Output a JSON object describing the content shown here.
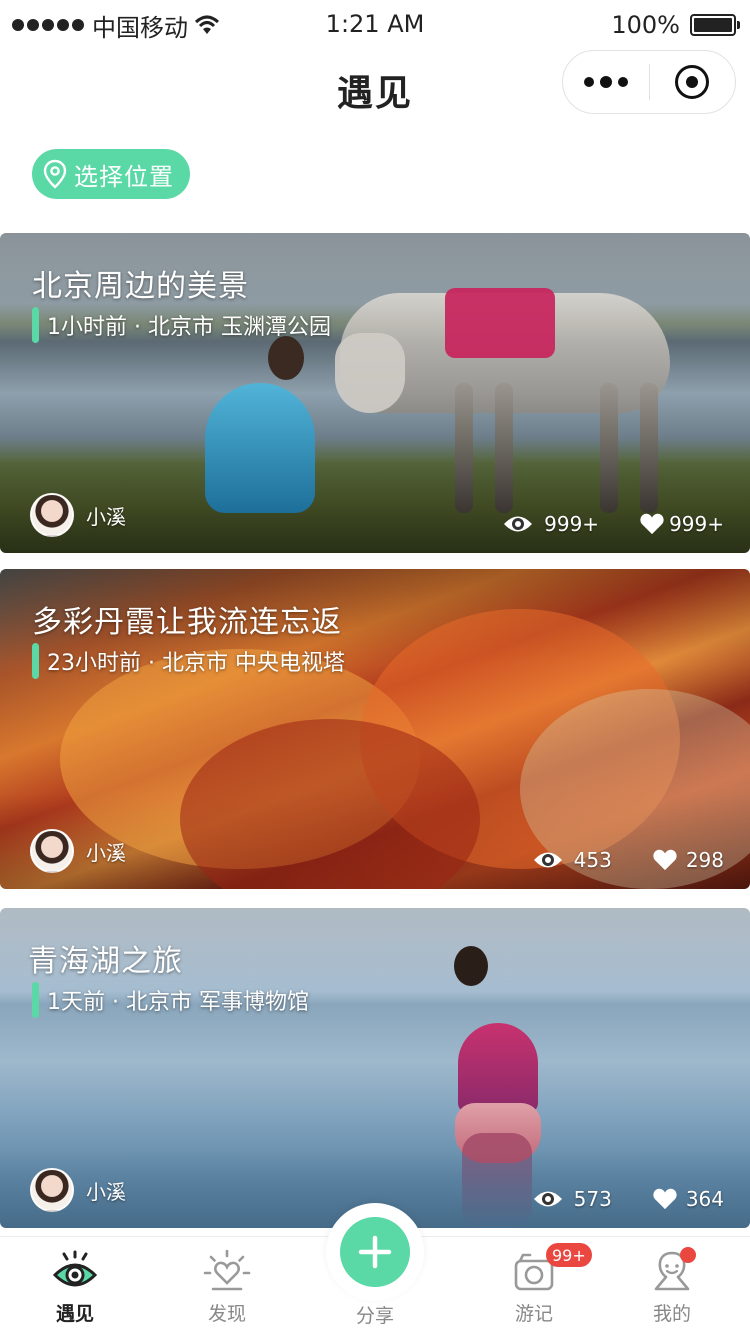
{
  "status_bar": {
    "carrier": "中国移动",
    "time": "1:21 AM",
    "battery": "100%"
  },
  "nav": {
    "title": "遇见"
  },
  "location_button": {
    "label": "选择位置"
  },
  "posts": [
    {
      "title": "北京周边的美景",
      "meta": "1小时前 · 北京市 玉渊潭公园",
      "author": "小溪",
      "views": "999+",
      "likes": "999+"
    },
    {
      "title": "多彩丹霞让我流连忘返",
      "meta": "23小时前 · 北京市 中央电视塔",
      "author": "小溪",
      "views": "453",
      "likes": "298"
    },
    {
      "title": "青海湖之旅",
      "meta": "1天前 · 北京市 军事博物馆",
      "author": "小溪",
      "views": "573",
      "likes": "364"
    }
  ],
  "tab_bar": {
    "meet": "遇见",
    "discover": "发现",
    "share": "分享",
    "journal": "游记",
    "journal_badge": "99+",
    "mine": "我的"
  },
  "colors": {
    "accent": "#5ad8a6",
    "badge": "#e9473f"
  },
  "icons": [
    "signal-icon",
    "wifi-icon",
    "battery-icon",
    "more-icon",
    "close-mini-program-icon",
    "location-pin-icon",
    "eye-icon",
    "heart-icon",
    "eye-tab-icon",
    "sun-heart-icon",
    "plus-icon",
    "camera-icon",
    "person-icon"
  ]
}
